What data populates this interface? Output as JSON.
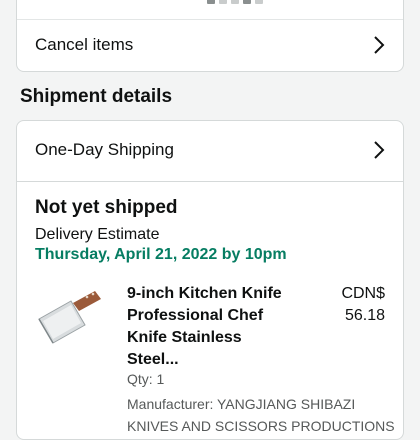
{
  "cancel_row": {
    "label": "Cancel items",
    "icon": "chevron-right-icon"
  },
  "shipment": {
    "section_title": "Shipment details",
    "shipping_option": "One-Day Shipping",
    "status": "Not yet shipped",
    "estimate_label": "Delivery Estimate",
    "estimate_date": "Thursday, April 21, 2022 by 10pm",
    "estimate_color": "#067d62"
  },
  "item": {
    "title": "9-inch Kitchen Knife Professional Chef Knife Stainless Steel...",
    "currency": "CDN$",
    "price": "56.18",
    "qty": "Qty: 1",
    "manufacturer": "Manufacturer: YANGJIANG SHIBAZI KNIVES AND SCISSORS PRODUCTIONS"
  }
}
